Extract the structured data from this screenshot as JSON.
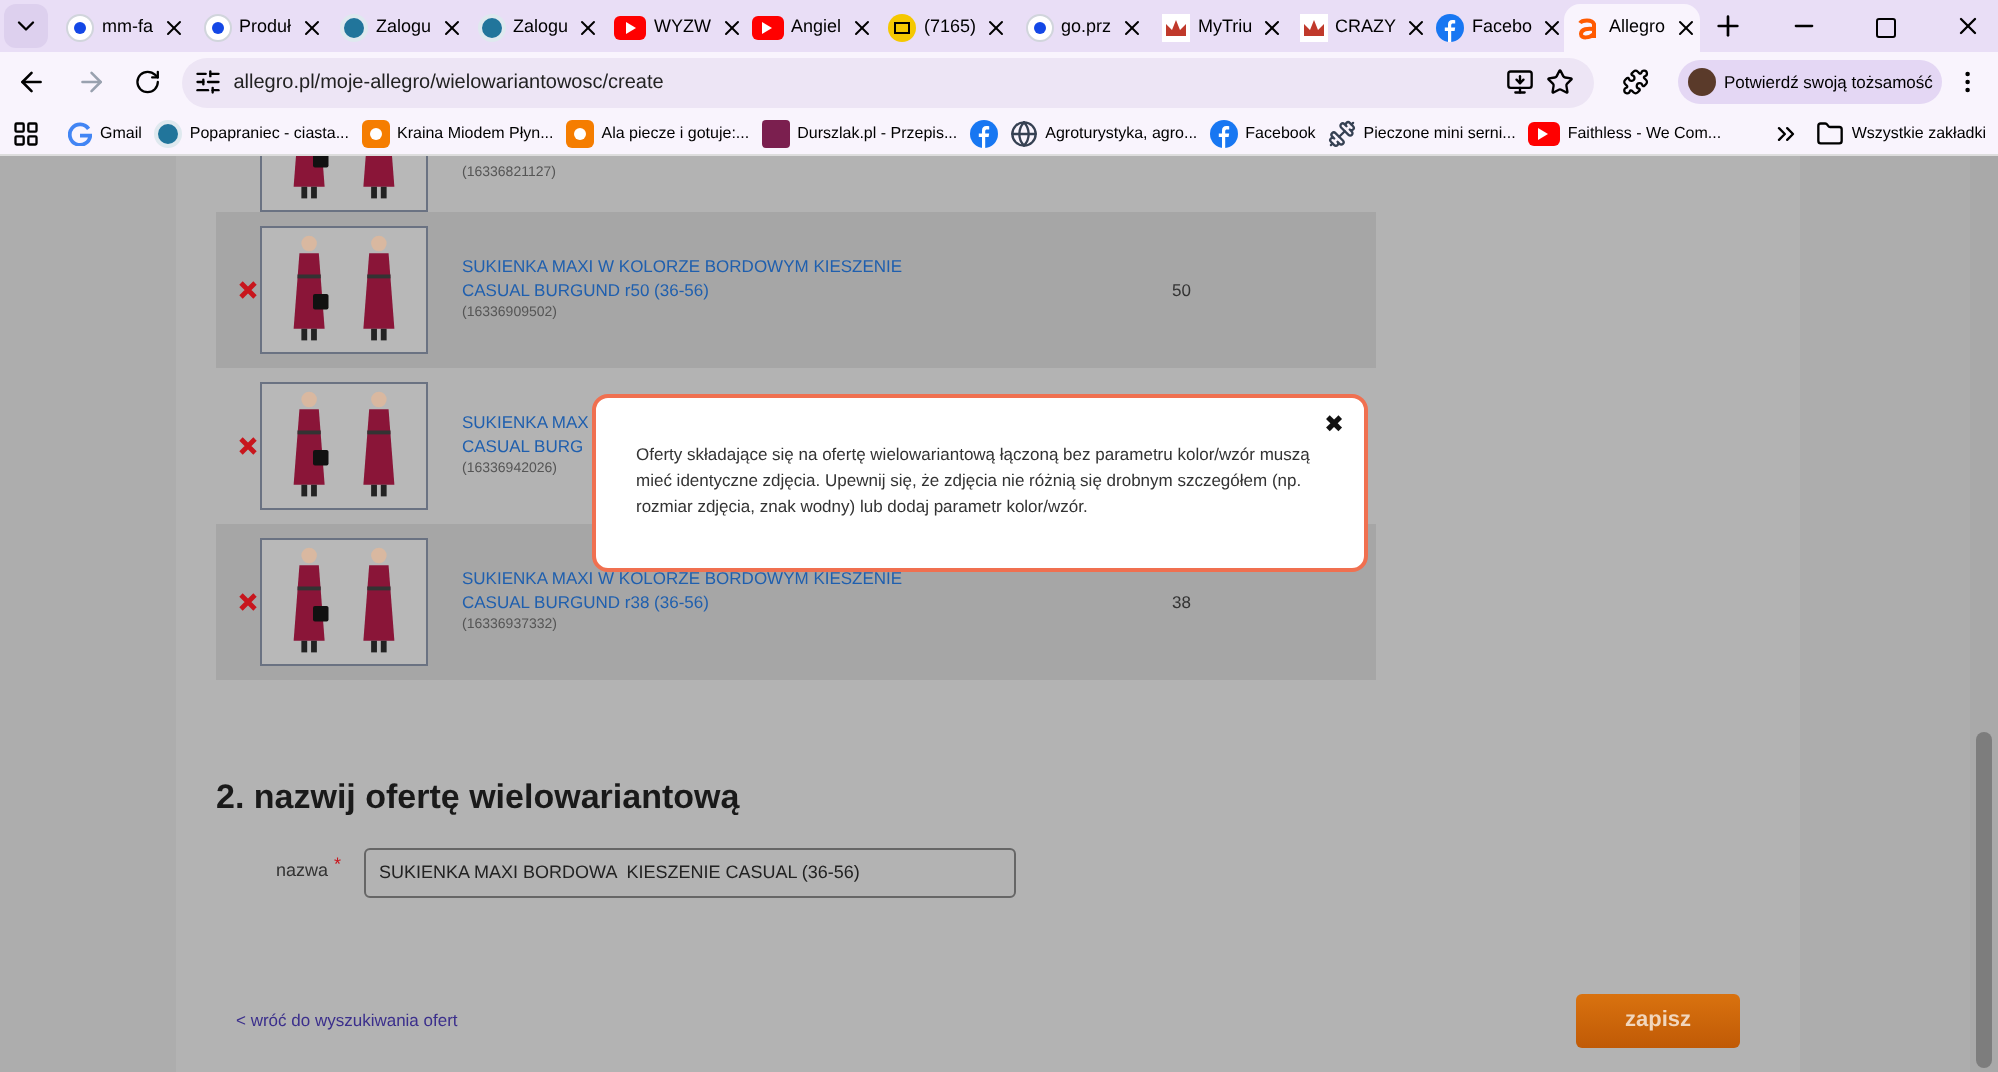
{
  "browser": {
    "tabs": [
      {
        "title": "mm-fa",
        "kind": "dot",
        "selected": false
      },
      {
        "title": "Produł",
        "kind": "dot",
        "selected": false
      },
      {
        "title": "Zalogu",
        "kind": "wp",
        "selected": false
      },
      {
        "title": "Zalogu",
        "kind": "wp",
        "selected": false
      },
      {
        "title": "WYZW",
        "kind": "yt",
        "selected": false
      },
      {
        "title": "Angiel",
        "kind": "yt",
        "selected": false
      },
      {
        "title": "(7165)",
        "kind": "mail",
        "selected": false
      },
      {
        "title": "go.prz",
        "kind": "dot",
        "selected": false
      },
      {
        "title": "MyTriu",
        "kind": "crown",
        "selected": false
      },
      {
        "title": "CRAZY",
        "kind": "crown",
        "selected": false
      },
      {
        "title": "Facebo",
        "kind": "fb",
        "selected": false
      },
      {
        "title": "Allegro",
        "kind": "a",
        "selected": true
      }
    ],
    "url": "allegro.pl/moje-allegro/wielowariantowosc/create",
    "profile_button": "Potwierdź swoją tożsamość",
    "bookmarks": [
      {
        "title": "Gmail",
        "kind": "g"
      },
      {
        "title": "Popapraniec - ciasta...",
        "kind": "wp"
      },
      {
        "title": "Kraina Miodem Płyn...",
        "kind": "blog"
      },
      {
        "title": "Ala piecze i gotuje:...",
        "kind": "blog"
      },
      {
        "title": "Durszlak.pl - Przepis...",
        "kind": "durszlak"
      },
      {
        "kind": "fb"
      },
      {
        "title": "Agroturystyka, agro...",
        "kind": "globe"
      },
      {
        "title": "Facebook",
        "kind": "fb"
      },
      {
        "title": "Pieczone mini serni...",
        "kind": "dumbbell"
      },
      {
        "title": "Faithless - We Com...",
        "kind": "yt"
      }
    ],
    "all_bookmarks": "Wszystkie zakładki"
  },
  "offers": [
    {
      "id": "(16336821127)"
    },
    {
      "title_lines": [
        "SUKIENKA MAXI W KOLORZE BORDOWYM KIESZENIE",
        "CASUAL BURGUND r50 (36-56)"
      ],
      "id": "(16336909502)",
      "quantity": "50"
    },
    {
      "title_lines": [
        "SUKIENKA MAX",
        "CASUAL BURG"
      ],
      "id": "(16336942026)"
    },
    {
      "title_lines": [
        "SUKIENKA MAXI W KOLORZE BORDOWYM KIESZENIE",
        "CASUAL BURGUND r38 (36-56)"
      ],
      "id": "(16336937332)",
      "quantity": "38"
    }
  ],
  "section_title": "2. nazwij ofertę wielowariantową",
  "name_field": {
    "label": "nazwa",
    "required_mark": "*",
    "value": "SUKIENKA MAXI BORDOWA  KIESZENIE CASUAL (36-56)"
  },
  "back_link": "< wróć do wyszukiwania ofert",
  "save_button": "zapisz",
  "modal": {
    "close": "✖",
    "message": "Oferty składające się na ofertę wielowariantową łączoną bez parametru kolor/wzór muszą mieć identyczne zdjęcia. Upewnij się, że zdjęcia nie różnią się drobnym szczegółem (np. rozmiar zdjęcia, znak wodny) lub dodaj parametr kolor/wzór."
  }
}
